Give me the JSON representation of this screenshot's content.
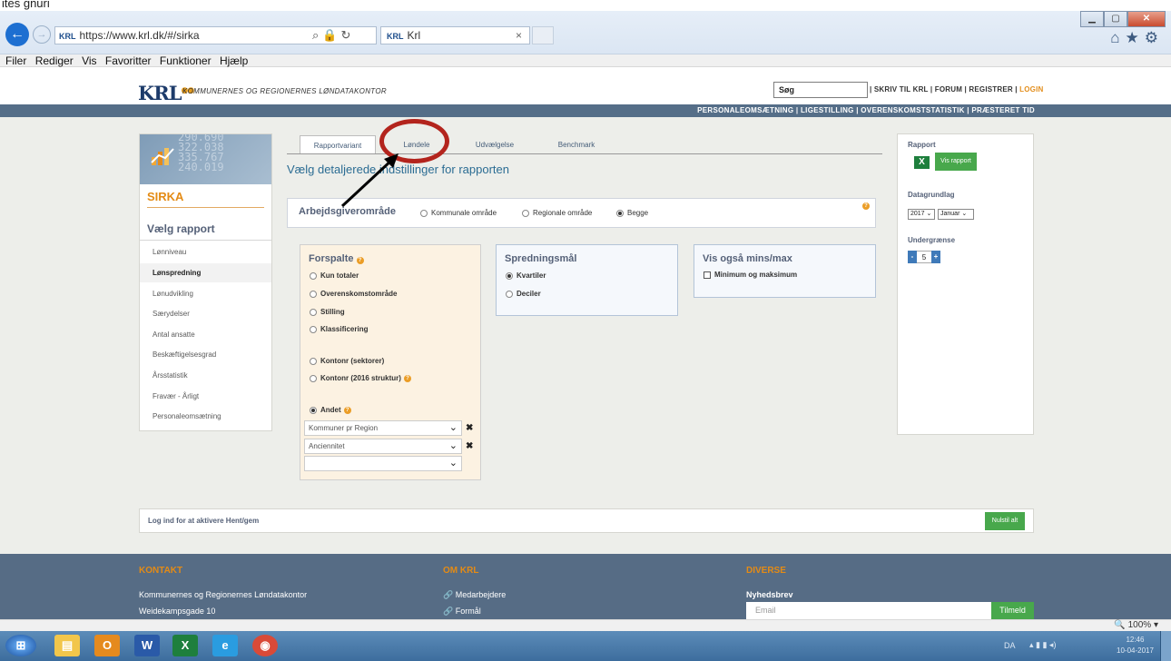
{
  "browser": {
    "top_fragment": "ites  gnuri",
    "url": "https://www.krl.dk/#/sirka",
    "url_favicon": "KRL",
    "tab_title": "Krl",
    "tab_favicon": "KRL",
    "tab_close": "×",
    "menu": [
      "Filer",
      "Rediger",
      "Vis",
      "Favoritter",
      "Funktioner",
      "Hjælp"
    ],
    "zoom": "100%"
  },
  "header": {
    "logo": "KRL",
    "logo_sub": "KOMMUNERNES OG REGIONERNES LØNDATAKONTOR",
    "search_value": "Søg",
    "links": "| SKRIV TIL KRL | FORUM | REGISTRER |",
    "login": "LOGIN",
    "nav": "PERSONALEOMSÆTNING | LIGESTILLING | OVERENSKOMSTSTATISTIK | PRÆSTERET TID"
  },
  "sidebar": {
    "hero_numbers": [
      "290.690",
      "322.038",
      "335.767",
      "240.019"
    ],
    "title": "SIRKA",
    "heading": "Vælg rapport",
    "items": [
      "Lønniveau",
      "Lønspredning",
      "Lønudvikling",
      "Særydelser",
      "Antal ansatte",
      "Beskæftigelsesgrad",
      "Årsstatistik",
      "Fravær - Årligt",
      "Personaleomsætning"
    ],
    "active_index": 1
  },
  "tabs": [
    "Rapportvariant",
    "Løndele",
    "Udvælgelse",
    "Benchmark"
  ],
  "subtitle": "Vælg detaljerede indstillinger for rapporten",
  "arbejd": {
    "label": "Arbejdsgiverområde",
    "options": [
      "Kommunale område",
      "Regionale område",
      "Begge"
    ],
    "selected": "Begge"
  },
  "forspalte": {
    "title": "Forspalte",
    "options": [
      "Kun totaler",
      "Overenskomstområde",
      "Stilling",
      "Klassificering",
      "Kontonr (sektorer)",
      "Kontonr (2016 struktur)",
      "Andet"
    ],
    "selected": "Andet",
    "selects": [
      "Kommuner pr Region",
      "Anciennitet",
      ""
    ]
  },
  "sprednings": {
    "title": "Spredningsmål",
    "options": [
      "Kvartiler",
      "Deciler"
    ],
    "selected": "Kvartiler"
  },
  "visogsaa": {
    "title": "Vis også mins/max",
    "checkbox": "Minimum og maksimum",
    "checked": false
  },
  "right": {
    "rapport_label": "Rapport",
    "vis_button": "Vis rapport",
    "datagrundlag_label": "Datagrundlag",
    "year": "2017",
    "month": "Januar",
    "undergraense_label": "Undergrænse",
    "undergraense_value": "5"
  },
  "login_bar": {
    "text": "Log ind for at aktivere Hent/gem",
    "reset": "Nulstil alt"
  },
  "footer": {
    "kontakt": "KONTAKT",
    "kontakt_lines": [
      "Kommunernes og Regionernes Løndatakontor",
      "Weidekampsgade 10"
    ],
    "om": "OM KRL",
    "om_links": [
      "Medarbejdere",
      "Formål"
    ],
    "diverse": "DIVERSE",
    "nyhedsbrev": "Nyhedsbrev",
    "email_placeholder": "Email",
    "tilmeld": "Tilmeld"
  },
  "taskbar": {
    "lang": "DA",
    "time": "12:46",
    "date": "10-04-2017"
  },
  "colors": {
    "accent_orange": "#e48b15",
    "nav_blue": "#556e88",
    "green_button": "#48a84c",
    "annotation_red": "#b3241d"
  }
}
